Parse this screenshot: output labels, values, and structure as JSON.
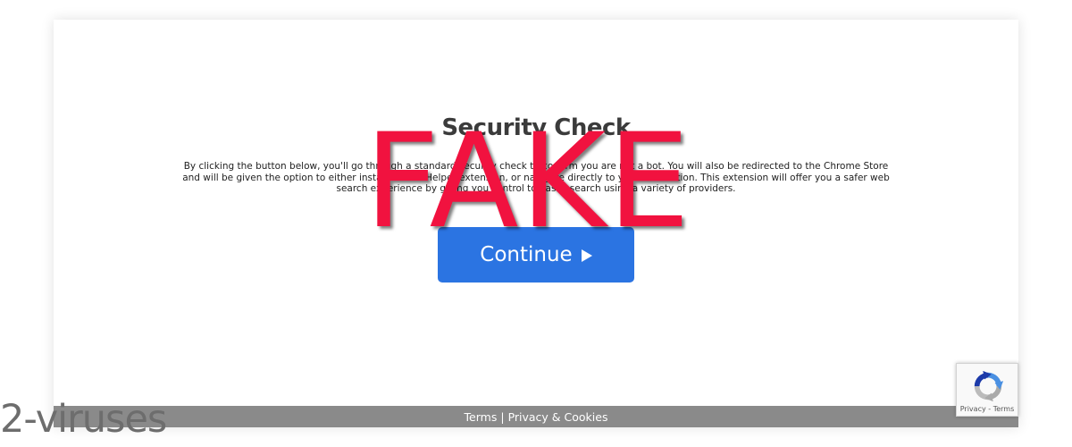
{
  "page": {
    "title": "Security Check",
    "description": "By clicking the button below, you'll go through a standard security check to confirm you are not a bot. You will also be redirected to the Chrome Store and will be given the option to either install Search Helper extension, or navigate directly to your destination. This extension will offer you a safer web search experience by giving you control to easily search using a variety of providers."
  },
  "button": {
    "label": "Continue",
    "icon": "play-icon",
    "color": "#2b74e2"
  },
  "footer": {
    "terms": "Terms",
    "separator": "|",
    "privacy": "Privacy & Cookies",
    "background": "#8a8a8a"
  },
  "recaptcha": {
    "icon": "recaptcha-icon",
    "privacy": "Privacy",
    "separator": "-",
    "terms": "Terms"
  },
  "overlay": {
    "stamp": "FAKE",
    "stamp_color": "#f1123f",
    "watermark": "2-viruses"
  }
}
